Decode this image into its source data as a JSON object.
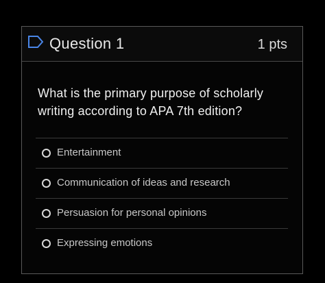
{
  "question": {
    "icon": "flag-outline-icon",
    "title": "Question 1",
    "points": "1 pts",
    "text": "What is the primary purpose of scholarly writing according to APA 7th edition?",
    "accent_color": "#4a86e8",
    "answers": [
      {
        "label": "Entertainment"
      },
      {
        "label": "Communication of ideas and research"
      },
      {
        "label": "Persuasion for personal opinions"
      },
      {
        "label": "Expressing emotions"
      }
    ]
  }
}
